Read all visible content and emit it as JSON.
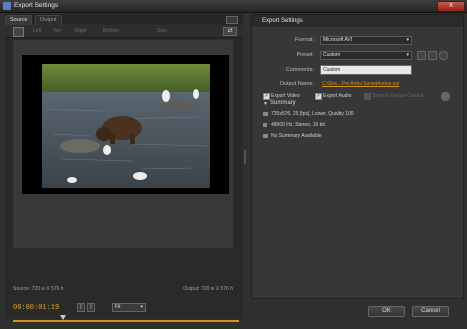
{
  "window": {
    "title": "Export Settings",
    "close": "X"
  },
  "left": {
    "tabs": [
      "Source",
      "Output"
    ],
    "toolbar": [
      "Left",
      "Top",
      "Right",
      "Bottom",
      "Size"
    ],
    "source_info": "Source: 720 w X 576 h",
    "output_info": "Output: 720 w X 576 h",
    "timecode": "00:00:01:19",
    "fit": "Fit"
  },
  "right": {
    "header": "Export Settings",
    "format_label": "Format:",
    "format_value": "Microsoft AVI",
    "preset_label": "Preset:",
    "preset_value": "Custom",
    "comments_label": "Comments:",
    "comments_value": "Custom",
    "output_name_label": "Output Name:",
    "output_name_value": "C:\\Doc...Pre Antoi SavedAvdoe.avi",
    "export_video": "Export Video",
    "export_audio": "Export Audio",
    "queue": "Send to Device Central",
    "summary_title": "Summary",
    "summary_lines": [
      "720x576, 25 [fps], Lower, Quality 100",
      "48000 Hz, Stereo, 16 bit",
      "No Summary Available"
    ]
  },
  "buttons": {
    "ok": "OK",
    "cancel": "Cancel"
  },
  "colors": {
    "accent": "#d8921c",
    "bg": "#303030"
  }
}
